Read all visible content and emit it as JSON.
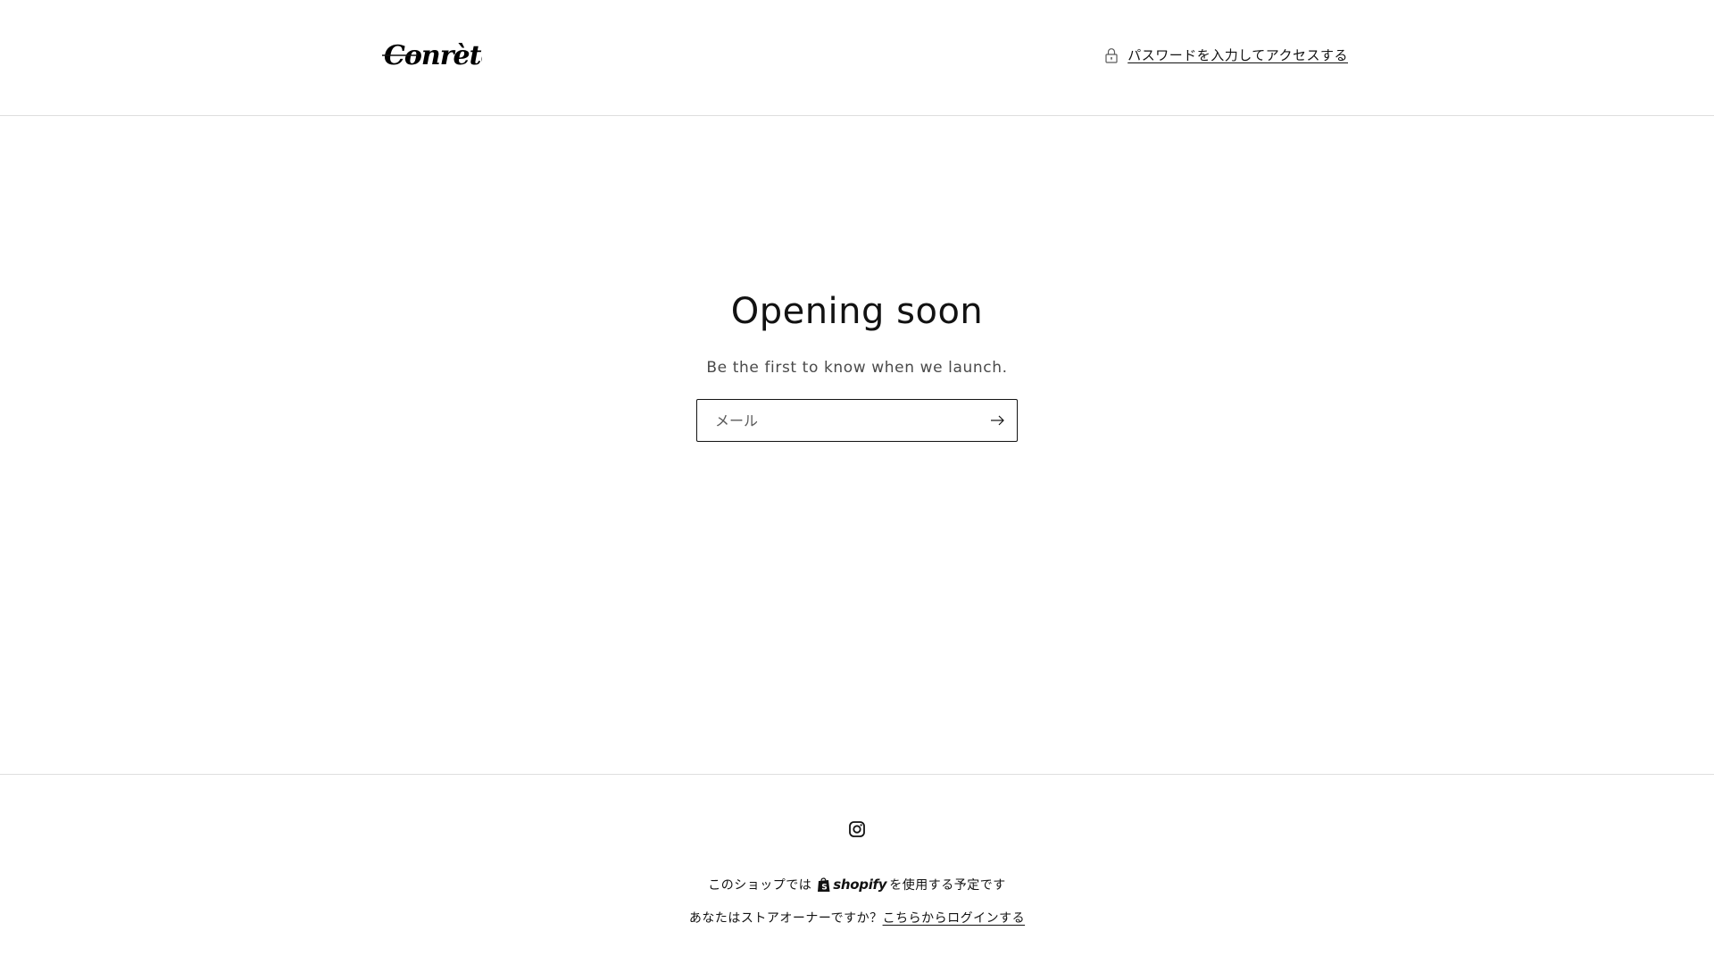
{
  "header": {
    "logo_text": "Conrète",
    "password_link": "パスワードを入力してアクセスする"
  },
  "main": {
    "title": "Opening soon",
    "subtitle": "Be the first to know when we launch.",
    "email_placeholder": "メール",
    "email_value": ""
  },
  "footer": {
    "social_icon": "instagram-icon",
    "powered_prefix": "このショップでは",
    "shopify_label": "shopify",
    "powered_suffix": "を使用する予定です",
    "owner_question": "あなたはストアオーナーですか？",
    "login_link": "こちらからログインする"
  },
  "colors": {
    "text": "#121212",
    "border": "#dedede",
    "subtext": "#4a4a4a"
  }
}
